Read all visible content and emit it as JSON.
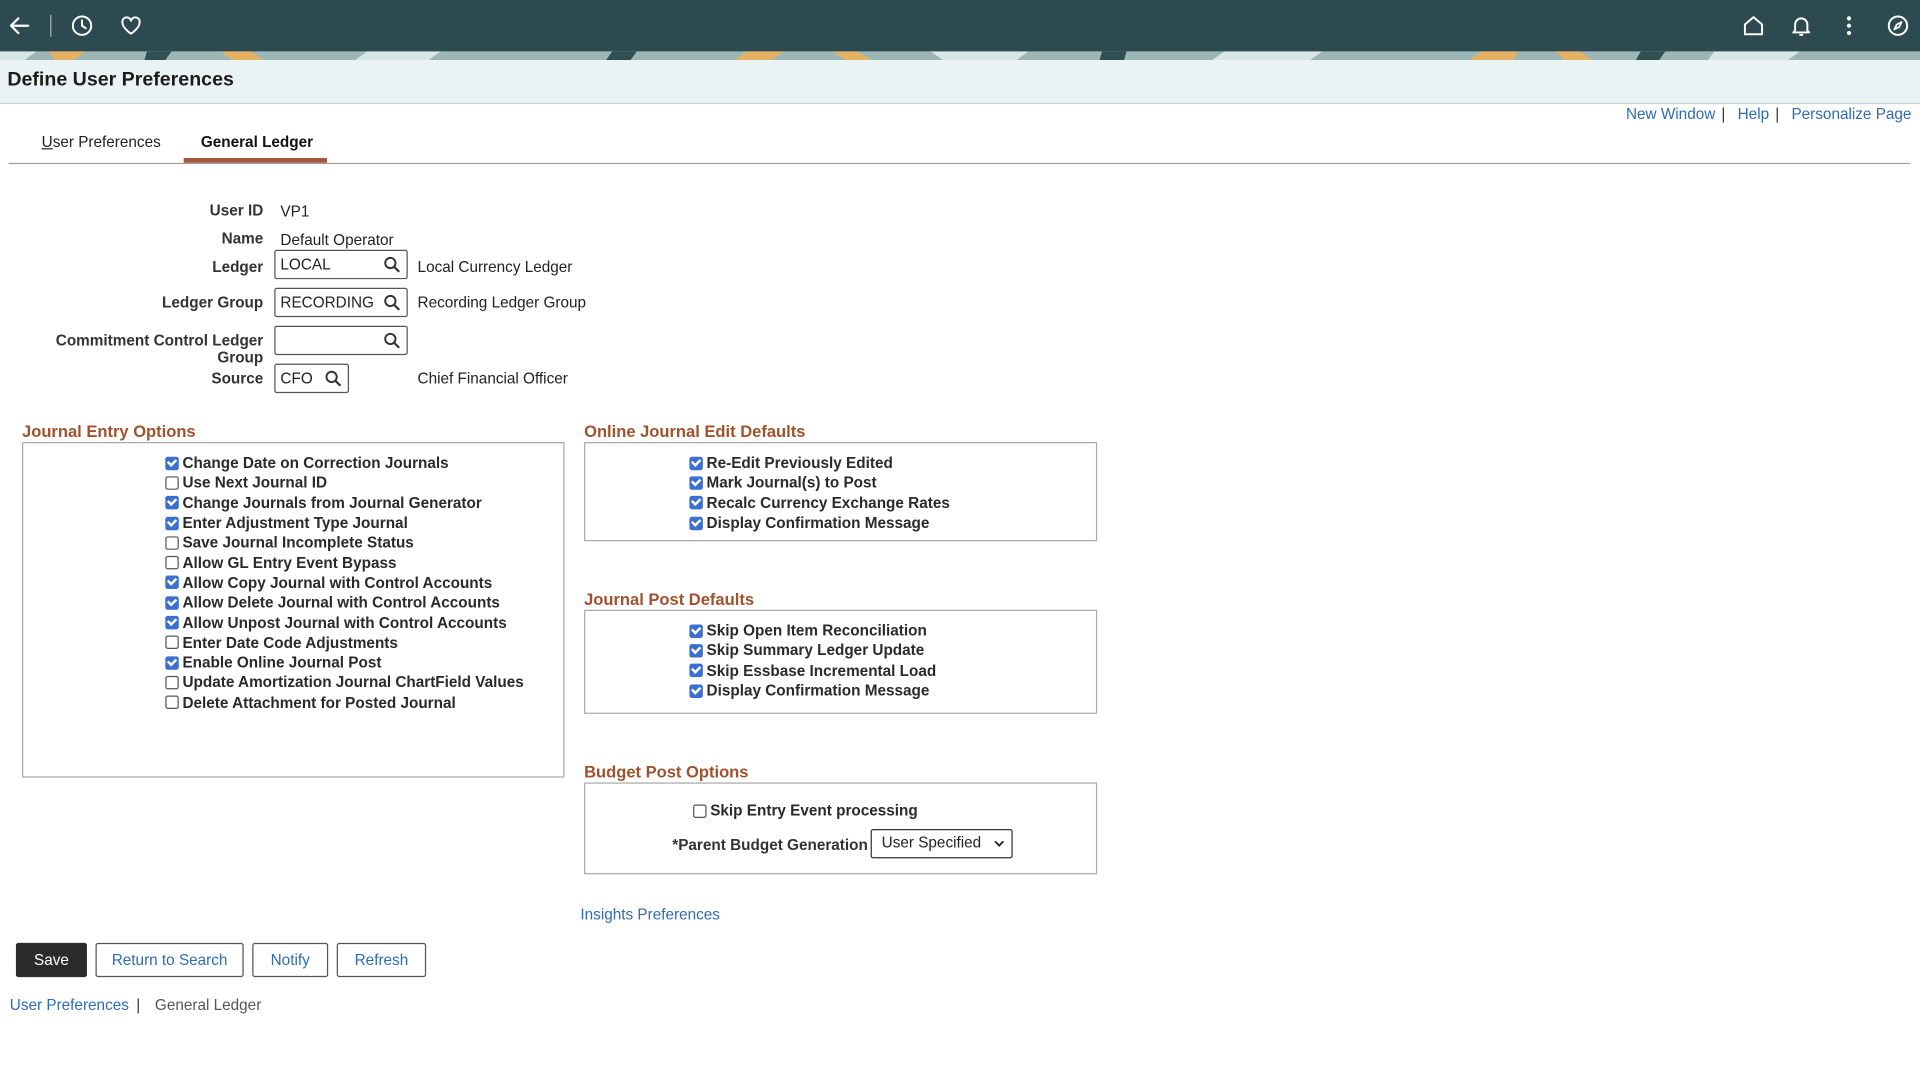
{
  "page": {
    "title": "Define User Preferences"
  },
  "top_links": {
    "new_window": "New Window",
    "help": "Help",
    "personalize": "Personalize Page",
    "pipe": "|"
  },
  "tabs": [
    {
      "label": "User Preferences",
      "accel": "U",
      "rest": "ser Preferences",
      "active": false
    },
    {
      "label": "General Ledger",
      "active": true
    }
  ],
  "fields": {
    "user_id": {
      "label": "User ID",
      "value": "VP1"
    },
    "name": {
      "label": "Name",
      "value": "Default Operator"
    },
    "ledger": {
      "label": "Ledger",
      "value": "LOCAL",
      "description": "Local Currency Ledger"
    },
    "ledger_group": {
      "label": "Ledger Group",
      "value": "RECORDING",
      "description": "Recording Ledger Group"
    },
    "commitment_group": {
      "label": "Commitment Control Ledger Group",
      "value": ""
    },
    "source": {
      "label": "Source",
      "value": "CFO",
      "description": "Chief Financial Officer"
    }
  },
  "journal_entry_options": {
    "title": "Journal Entry Options",
    "items": [
      {
        "label": "Change Date on Correction Journals",
        "checked": true
      },
      {
        "label": "Use Next Journal ID",
        "checked": false
      },
      {
        "label": "Change Journals from Journal Generator",
        "checked": true
      },
      {
        "label": "Enter Adjustment Type Journal",
        "checked": true
      },
      {
        "label": "Save Journal Incomplete Status",
        "checked": false
      },
      {
        "label": "Allow GL Entry Event Bypass",
        "checked": false
      },
      {
        "label": "Allow Copy Journal with Control Accounts",
        "checked": true
      },
      {
        "label": "Allow Delete Journal with Control Accounts",
        "checked": true
      },
      {
        "label": "Allow Unpost Journal with Control Accounts",
        "checked": true
      },
      {
        "label": "Enter Date Code Adjustments",
        "checked": false
      },
      {
        "label": "Enable Online Journal Post",
        "checked": true
      },
      {
        "label": "Update Amortization Journal ChartField Values",
        "checked": false
      },
      {
        "label": "Delete Attachment for Posted Journal",
        "checked": false
      }
    ]
  },
  "online_edit_defaults": {
    "title": "Online Journal Edit Defaults",
    "items": [
      {
        "label": "Re-Edit Previously Edited",
        "checked": true
      },
      {
        "label": "Mark Journal(s) to Post",
        "checked": true
      },
      {
        "label": "Recalc Currency Exchange Rates",
        "checked": true
      },
      {
        "label": "Display Confirmation Message",
        "checked": true
      }
    ]
  },
  "post_defaults": {
    "title": "Journal Post Defaults",
    "items": [
      {
        "label": "Skip Open Item Reconciliation",
        "checked": true
      },
      {
        "label": "Skip Summary Ledger Update",
        "checked": true
      },
      {
        "label": "Skip Essbase Incremental Load",
        "checked": true
      },
      {
        "label": "Display Confirmation Message",
        "checked": true
      }
    ]
  },
  "budget_post": {
    "title": "Budget Post Options",
    "skip_entry_event": {
      "label": "Skip Entry Event processing",
      "checked": false
    },
    "parent_budget": {
      "label": "*Parent Budget Generation",
      "value": "User Specified"
    }
  },
  "insights_link": "Insights Preferences",
  "buttons": {
    "save": "Save",
    "return": "Return to Search",
    "notify": "Notify",
    "refresh": "Refresh"
  },
  "bottom_nav": {
    "user_prefs": "User Preferences",
    "general_ledger": "General Ledger",
    "pipe": "|"
  },
  "icons": {
    "back": "back-arrow-icon",
    "history": "history-icon",
    "favorites": "heart-icon",
    "home": "home-icon",
    "notifications": "bell-icon",
    "actions": "kebab-icon",
    "navigator": "compass-icon",
    "lookup": "search-icon"
  },
  "colors": {
    "header_bg": "#2c4a4f",
    "section_title": "#a0522d",
    "link": "#2e6bb5",
    "tab_active": "#a5583c",
    "checkbox_on": "#3b6fd0"
  }
}
